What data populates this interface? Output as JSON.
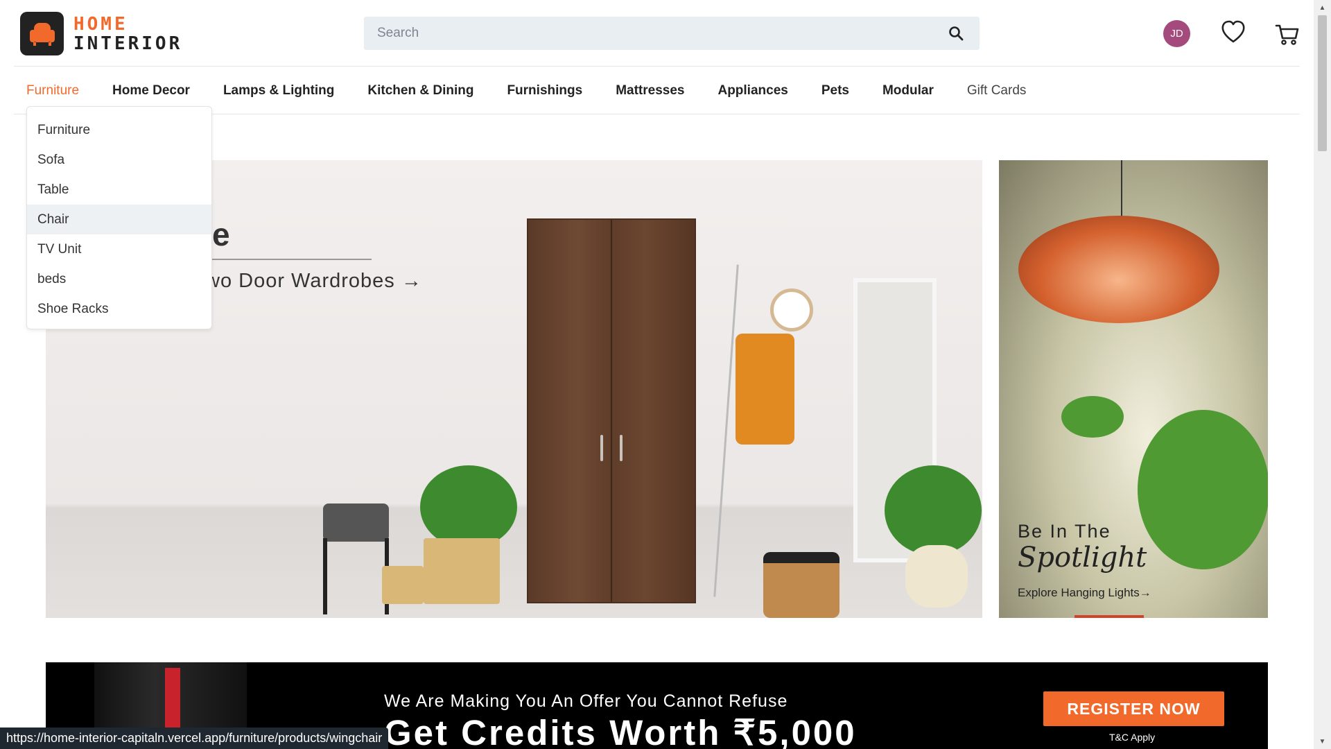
{
  "brand": {
    "line1": "HOME",
    "line2": "INTERIOR"
  },
  "search": {
    "placeholder": "Search",
    "value": ""
  },
  "user": {
    "initials": "JD"
  },
  "nav": {
    "items": [
      {
        "label": "Furniture"
      },
      {
        "label": "Home Decor"
      },
      {
        "label": "Lamps & Lighting"
      },
      {
        "label": "Kitchen & Dining"
      },
      {
        "label": "Furnishings"
      },
      {
        "label": "Mattresses"
      },
      {
        "label": "Appliances"
      },
      {
        "label": "Pets"
      },
      {
        "label": "Modular"
      },
      {
        "label": "Gift Cards"
      }
    ],
    "active": "Furniture"
  },
  "dropdown": {
    "items": [
      {
        "label": "Furniture"
      },
      {
        "label": "Sofa"
      },
      {
        "label": "Table"
      },
      {
        "label": "Chair"
      },
      {
        "label": "TV Unit"
      },
      {
        "label": "beds"
      },
      {
        "label": "Shoe Racks"
      }
    ],
    "hovered": "Chair"
  },
  "hero": {
    "title_fragment": "e",
    "subtitle": "wo Door Wardrobes →"
  },
  "side_banner": {
    "title": "Be In The",
    "script": "Spotlight",
    "cta": "Explore Hanging Lights→"
  },
  "promo": {
    "line1": "We Are Making You An Offer You Cannot Refuse",
    "line2": "Get Credits Worth ₹5,000",
    "button": "REGISTER NOW",
    "tnc": "T&C Apply"
  },
  "status_url": "https://home-interior-capitaln.vercel.app/furniture/products/wingchair",
  "colors": {
    "accent": "#f26a2b",
    "avatar": "#a44a7c",
    "search_bg": "#e9eef3"
  }
}
